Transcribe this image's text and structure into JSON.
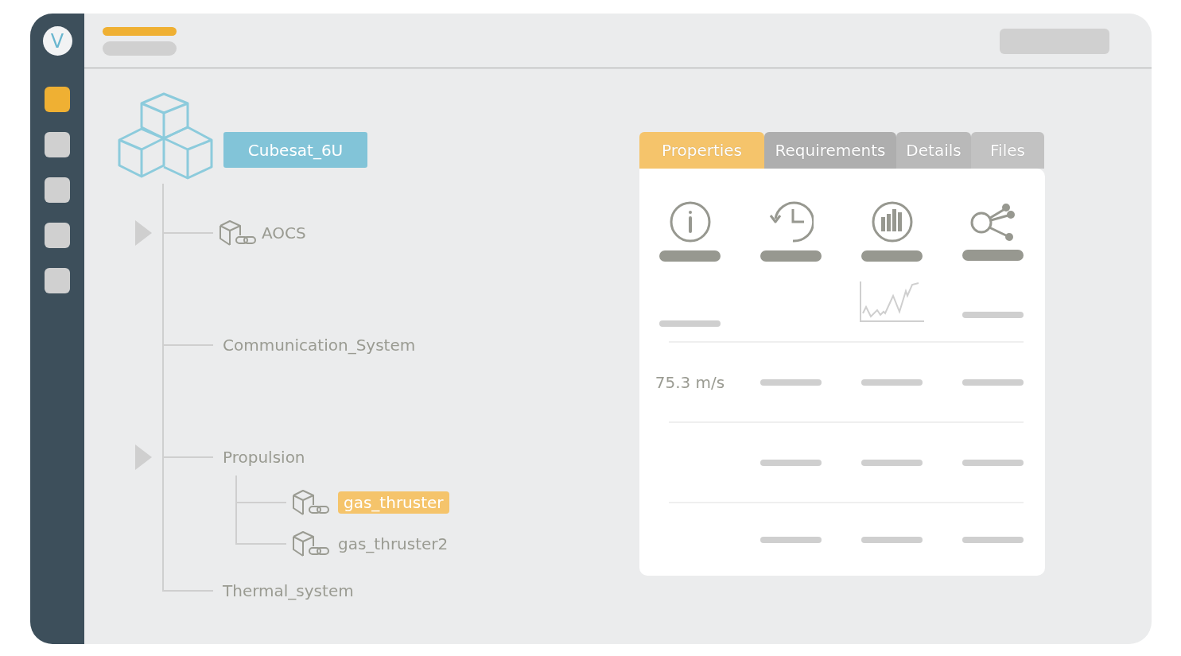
{
  "logo": "V",
  "sidebar": {
    "items": [
      {
        "selected": true
      },
      {
        "selected": false
      },
      {
        "selected": false
      },
      {
        "selected": false
      },
      {
        "selected": false
      }
    ]
  },
  "tree": {
    "root": "Cubesat_6U",
    "children": [
      {
        "label": "AOCS",
        "kind": "component",
        "toggle": true,
        "selected": false
      },
      {
        "label": "Communication_System",
        "kind": "group",
        "toggle": false,
        "selected": false
      },
      {
        "label": "Propulsion",
        "kind": "group",
        "toggle": true,
        "selected": false,
        "children": [
          {
            "label": "gas_thruster",
            "kind": "component",
            "toggle": false,
            "selected": true
          },
          {
            "label": "gas_thruster2",
            "kind": "component",
            "toggle": false,
            "selected": false
          }
        ]
      },
      {
        "label": "Thermal_system",
        "kind": "group",
        "toggle": false,
        "selected": false
      }
    ]
  },
  "panel": {
    "tabs": [
      {
        "label": "Properties",
        "selected": true
      },
      {
        "label": "Requirements",
        "selected": false
      },
      {
        "label": "Details",
        "selected": false
      },
      {
        "label": "Files",
        "selected": false
      }
    ],
    "value": "75.3 m/s"
  }
}
